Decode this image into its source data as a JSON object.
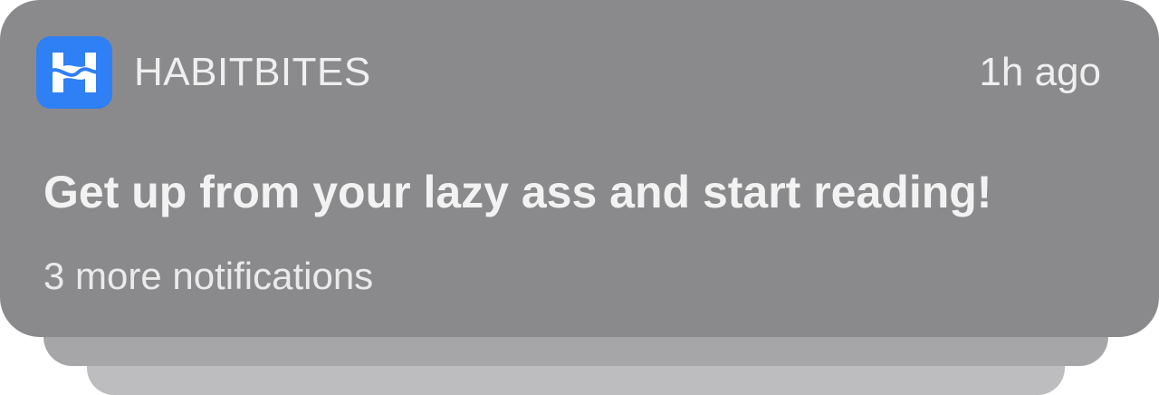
{
  "notification": {
    "app_icon": "habitbites-logo-icon",
    "app_name": "HABITBITES",
    "time": "1h ago",
    "message": "Get up from your lazy ass and start reading!",
    "more_label": "3 more notifications"
  },
  "colors": {
    "card_background": "#8a8a8c",
    "stack_middle": "#a6a6a8",
    "stack_back": "#bdbdc0",
    "icon_background": "#2f7ff5",
    "text": "#efefef"
  }
}
